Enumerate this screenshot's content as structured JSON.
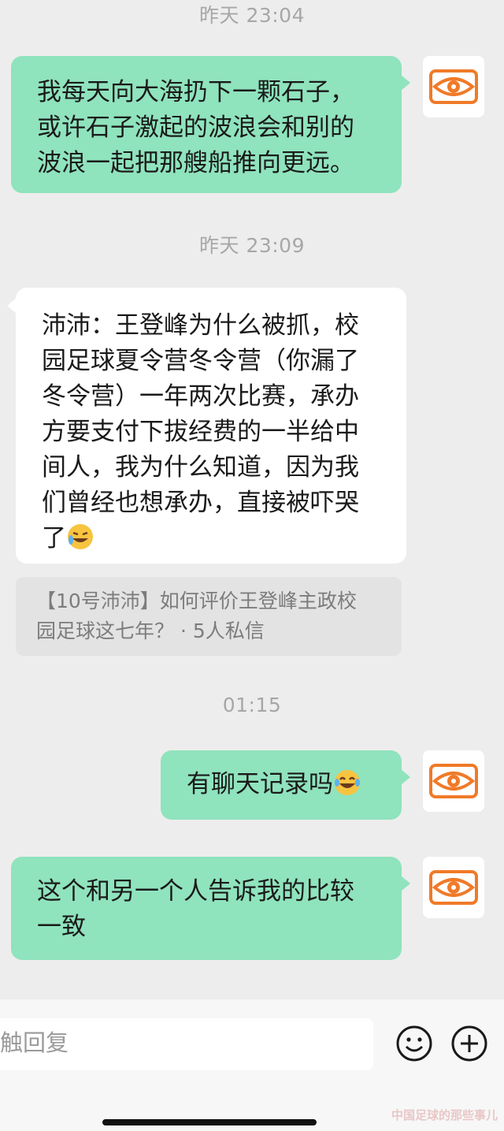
{
  "messages": [
    {
      "type": "timestamp",
      "text": "昨天 23:04"
    },
    {
      "type": "sent",
      "lines": [
        "我每天向大海扔下一颗石子，",
        "或许石子激起的波浪会和别的",
        "波浪一起把那艘船推向更远。"
      ]
    },
    {
      "type": "timestamp",
      "text": "昨天 23:09"
    },
    {
      "type": "received",
      "lines": [
        "沛沛：王登峰为什么被抓，校",
        "园足球夏令营冬令营（你漏了",
        "冬令营）一年两次比赛，承办",
        "方要支付下拔经费的一半给中",
        "间人，我为什么知道，因为我",
        "们曾经也想承办，直接被吓哭",
        "了"
      ],
      "emoji": "grin-sweat-emoji"
    },
    {
      "type": "quote",
      "lines": [
        "【10号沛沛】如何评价王登峰主政校",
        "园足球这七年？ · 5人私信"
      ]
    },
    {
      "type": "timestamp",
      "text": "01:15"
    },
    {
      "type": "sent",
      "text": "有聊天记录吗",
      "emoji": "laughing-tears-emoji"
    },
    {
      "type": "sent",
      "lines": [
        "这个和另一个人告诉我的比较",
        "一致"
      ]
    }
  ],
  "input": {
    "placeholder": "触回复"
  },
  "watermark": "中国足球的那些事儿",
  "colors": {
    "sent_bubble": "#8fe3bd",
    "received_bubble": "#ffffff",
    "background": "#ededed",
    "avatar_accent": "#f07a28"
  }
}
